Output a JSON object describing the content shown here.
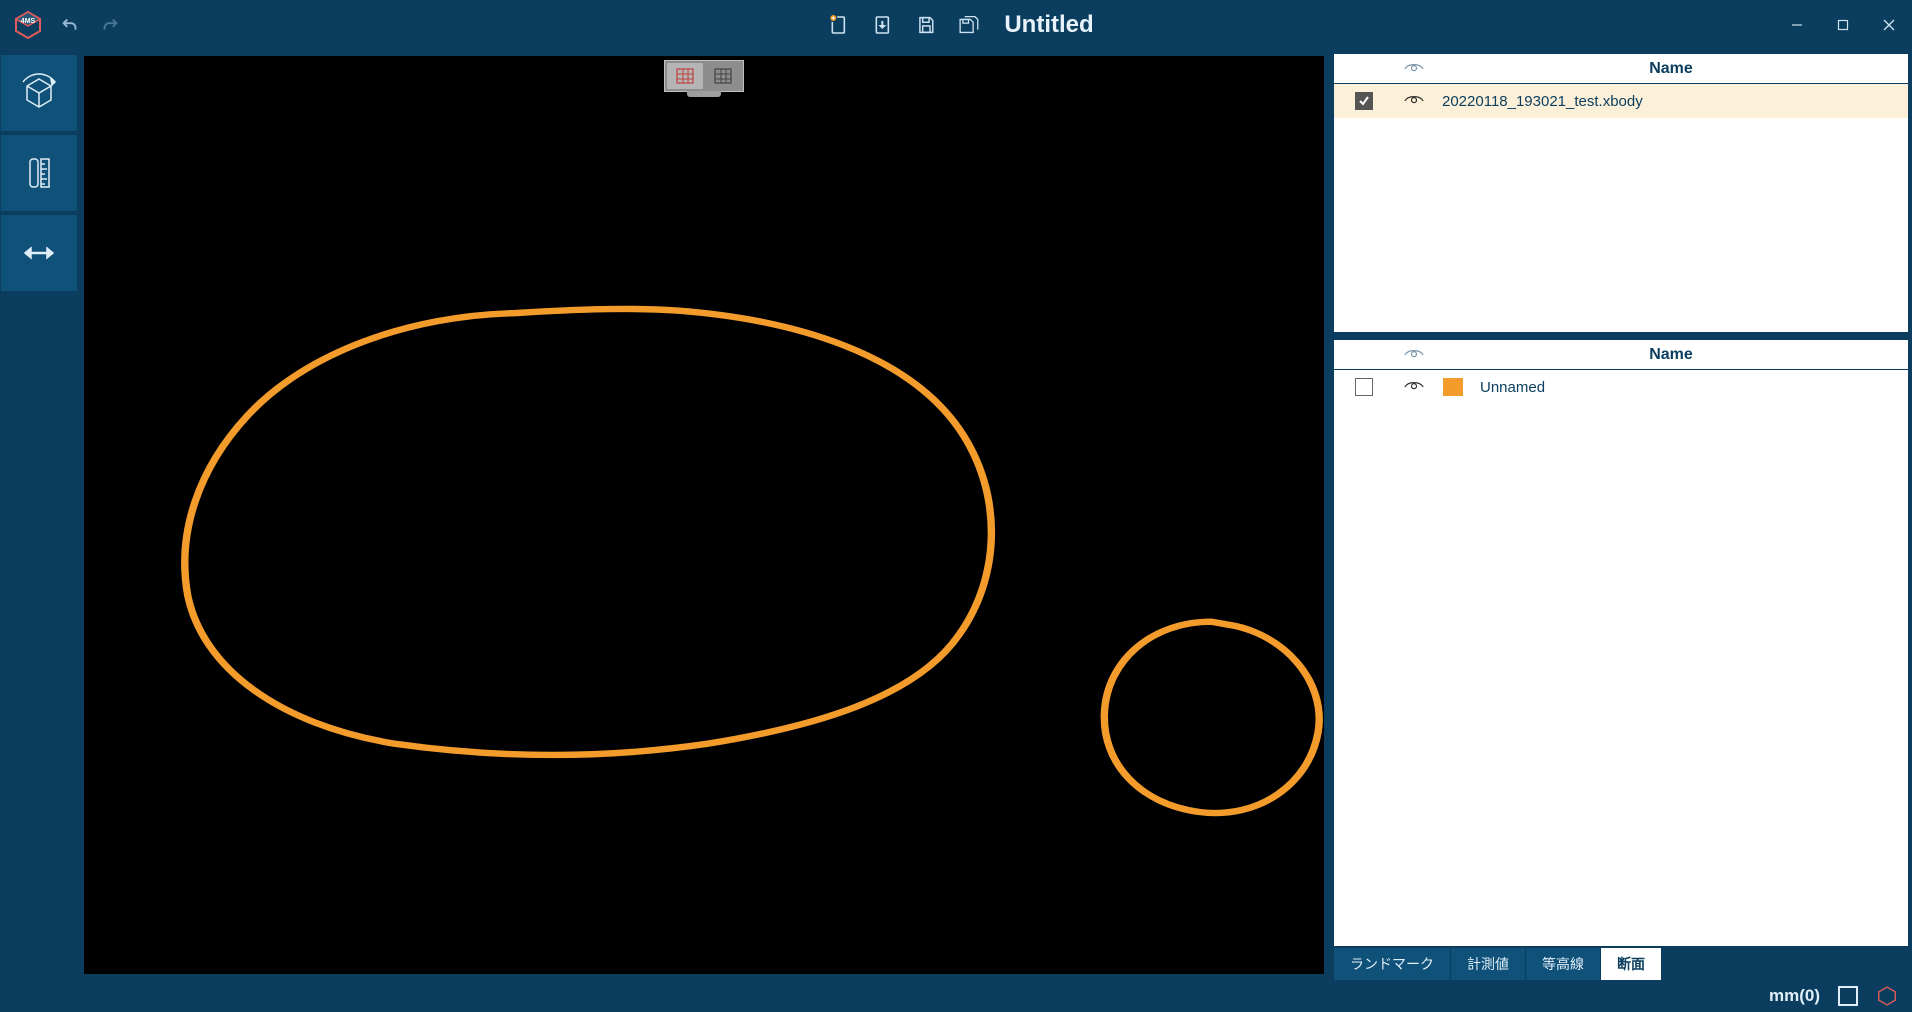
{
  "title": "Untitled",
  "sidebar": {
    "items": [
      "model",
      "measure",
      "fit"
    ]
  },
  "panels": {
    "top": {
      "header_name": "Name",
      "rows": [
        {
          "checked": true,
          "visible": true,
          "name": "20220118_193021_test.xbody"
        }
      ]
    },
    "mid": {
      "header_name": "Name",
      "rows": [
        {
          "checked": false,
          "visible": true,
          "color": "#f39c2c",
          "name": "Unnamed"
        }
      ]
    }
  },
  "tabs": {
    "items": [
      "ランドマーク",
      "計測値",
      "等高線",
      "断面"
    ],
    "active": 3
  },
  "status": {
    "units": "mm(0)"
  },
  "curve_color": "#f39c2c"
}
